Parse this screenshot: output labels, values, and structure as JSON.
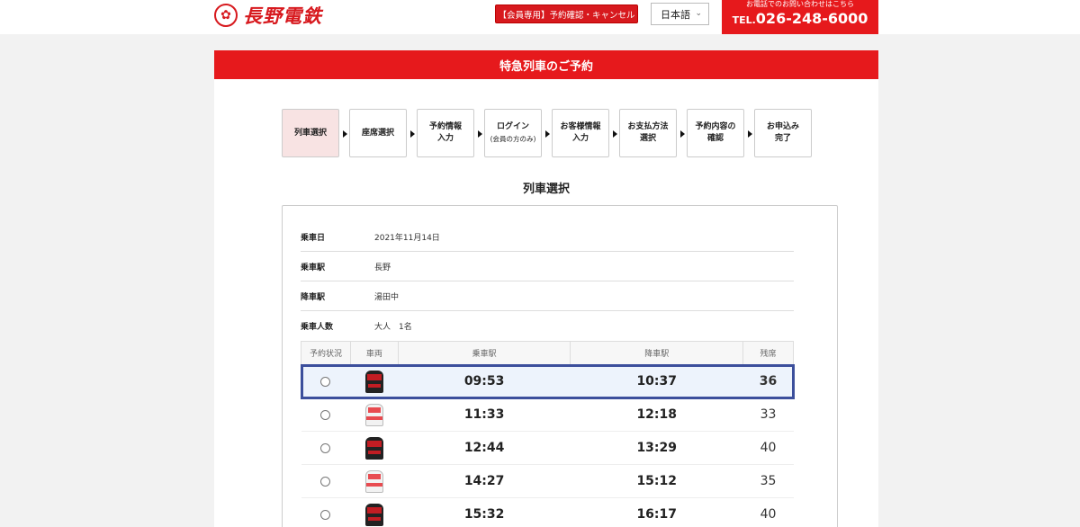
{
  "header": {
    "logo_mark": "✿",
    "logo_text": "長野電鉄",
    "member_button": "【会員専用】予約確認・キャンセル",
    "language": "日本語",
    "tel_note": "お電話でのお問い合わせはこちら",
    "tel_prefix": "TEL.",
    "tel_number": "026-248-6000"
  },
  "page": {
    "title": "特急列車のご予約",
    "section_title": "列車選択"
  },
  "steps": [
    {
      "label": "列車選択",
      "sub": ""
    },
    {
      "label": "座席選択",
      "sub": ""
    },
    {
      "label": "予約情報",
      "sub": "入力"
    },
    {
      "label": "ログイン",
      "sub": "(会員の方のみ)"
    },
    {
      "label": "お客様情報",
      "sub": "入力"
    },
    {
      "label": "お支払方法",
      "sub": "選択"
    },
    {
      "label": "予約内容の",
      "sub": "確認"
    },
    {
      "label": "お申込み",
      "sub": "完了"
    }
  ],
  "info": [
    {
      "label": "乗車日",
      "value": "2021年11月14日"
    },
    {
      "label": "乗車駅",
      "value": "長野"
    },
    {
      "label": "降車駅",
      "value": "湯田中"
    },
    {
      "label": "乗車人数",
      "value": "大人　1名"
    }
  ],
  "table": {
    "headers": [
      "予約状況",
      "車両",
      "乗車駅",
      "降車駅",
      "残席"
    ],
    "rows": [
      {
        "train": "dark",
        "depart": "09:53",
        "arrive": "10:37",
        "seats": "36",
        "selected": true
      },
      {
        "train": "white",
        "depart": "11:33",
        "arrive": "12:18",
        "seats": "33",
        "selected": false
      },
      {
        "train": "dark",
        "depart": "12:44",
        "arrive": "13:29",
        "seats": "40",
        "selected": false
      },
      {
        "train": "white",
        "depart": "14:27",
        "arrive": "15:12",
        "seats": "35",
        "selected": false
      },
      {
        "train": "dark",
        "depart": "15:32",
        "arrive": "16:17",
        "seats": "40",
        "selected": false
      }
    ]
  },
  "colors": {
    "brand_red": "#e6191c",
    "selected_border": "#3c4f9c",
    "active_step_bg": "#f8e3e3"
  }
}
